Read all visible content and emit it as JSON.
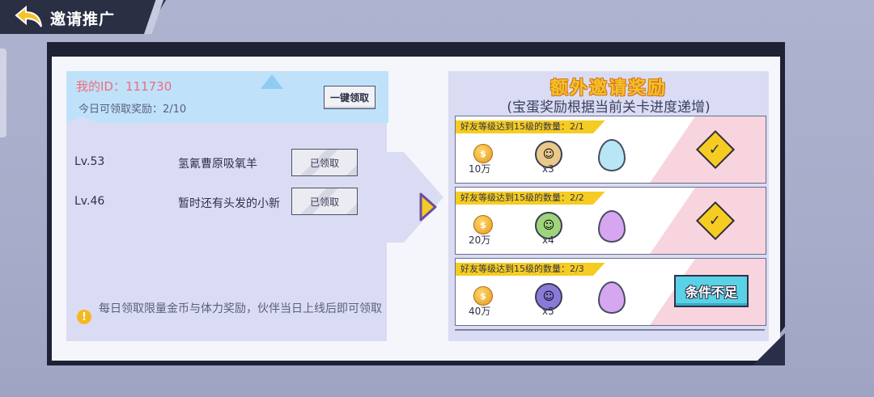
{
  "header": {
    "title": "邀请推广"
  },
  "invite_panel": {
    "my_id_label": "我的ID：111730",
    "today_claimable": "今日可领取奖励：2/10",
    "claim_all_label": "一键领取",
    "friends": [
      {
        "level": "Lv.53",
        "name": "氢氰曹原吸氧羊",
        "button": "已领取"
      },
      {
        "level": "Lv.46",
        "name": "暂时还有头发的小新",
        "button": "已领取"
      }
    ],
    "notice": "每日领取限量金币与体力奖励，伙伴当日上线后即可领取"
  },
  "extra_rewards": {
    "title": "额外邀请奖励",
    "subtitle": "(宝蛋奖励根据当前关卡进度递增)",
    "tiers": [
      {
        "condition": "好友等级达到15级的数量：2/1",
        "coin_amount": "10万",
        "hero_qty": "x3",
        "egg": "crystal-egg",
        "egg_color": "#b8e6f5",
        "status": "claimed"
      },
      {
        "condition": "好友等级达到15级的数量：2/2",
        "coin_amount": "20万",
        "hero_qty": "x4",
        "egg": "purple-egg",
        "egg_color": "#d7a6f0",
        "status": "claimed"
      },
      {
        "condition": "好友等级达到15级的数量：2/3",
        "coin_amount": "40万",
        "hero_qty": "x5",
        "egg": "purple-egg",
        "egg_color": "#d7a6f0",
        "status": "条件不足"
      }
    ]
  },
  "colors": {
    "accent_yellow": "#f6cc22",
    "id_pink": "#f06b7e",
    "cond_cyan": "#5ad2e6"
  }
}
